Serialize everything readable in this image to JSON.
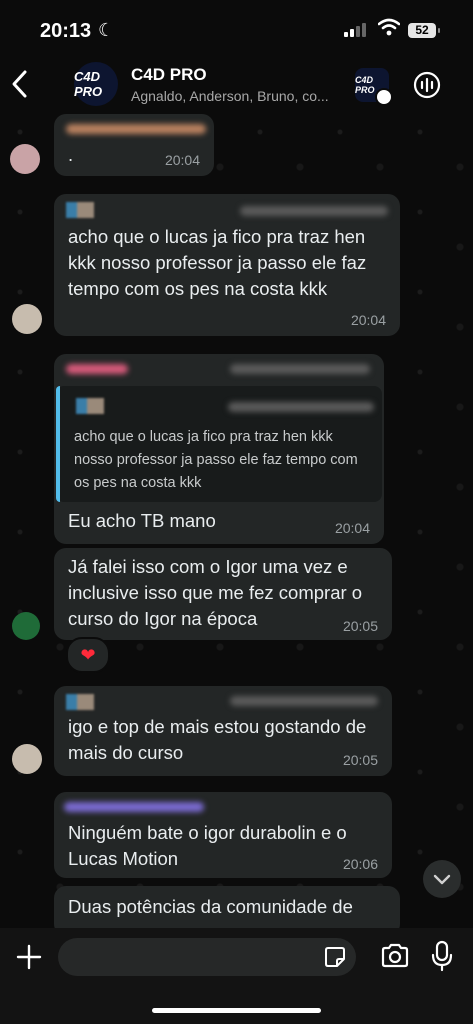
{
  "status_bar": {
    "time": "20:13",
    "moon_icon": "☾",
    "battery": "52"
  },
  "header": {
    "title": "C4D PRO",
    "subtitle": "Agnaldo, Anderson, Bruno, co...",
    "avatar_text": "C4D PRO",
    "community_avatar_text": "C4D PRO"
  },
  "messages": [
    {
      "text": ".",
      "time": "20:04"
    },
    {
      "text": "acho que o lucas ja fico pra traz hen kkk nosso professor ja passo ele faz tempo com os pes na costa kkk",
      "time": "20:04"
    },
    {
      "quote": "acho que o lucas ja fico pra traz hen kkk nosso professor ja passo ele faz tempo com os pes na costa kkk",
      "text": "Eu acho TB mano",
      "time": "20:04"
    },
    {
      "text": "Já falei isso com o Igor uma vez e inclusive isso que me fez comprar o curso do Igor na época",
      "time": "20:05",
      "reaction": "❤"
    },
    {
      "text": "igo e top de mais estou gostando de mais do curso",
      "time": "20:05"
    },
    {
      "text": "Ninguém bate o igor durabolin e o Lucas Motion",
      "time": "20:06"
    },
    {
      "text": "Duas potências da comunidade de"
    }
  ],
  "colors": {
    "bubble": "#232626",
    "quote_bar": "#53bdeb",
    "background": "#0b0b0b"
  },
  "icons": {
    "back": "chevron-left-icon",
    "voice": "voice-chat-icon",
    "plus": "plus-icon",
    "sticker": "sticker-icon",
    "camera": "camera-icon",
    "mic": "microphone-icon",
    "scroll": "chevron-down-icon"
  }
}
